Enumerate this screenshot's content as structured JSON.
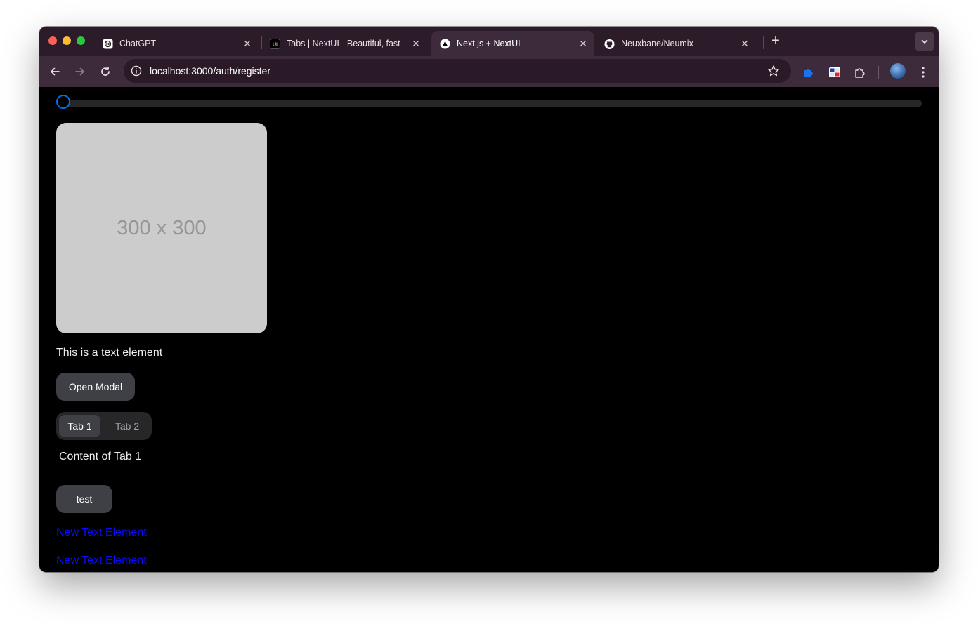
{
  "browser": {
    "tabs": [
      {
        "title": "ChatGPT",
        "icon": "chatgpt-icon",
        "active": false
      },
      {
        "title": "Tabs | NextUI - Beautiful, fast",
        "icon": "nextui-icon",
        "active": false
      },
      {
        "title": "Next.js + NextUI",
        "icon": "nextjs-icon",
        "active": true
      },
      {
        "title": "Neuxbane/Neumix",
        "icon": "github-icon",
        "active": false
      }
    ],
    "new_tab_label": "+",
    "address": {
      "host": "localhost",
      "rest": ":3000/auth/register"
    }
  },
  "page": {
    "slider": {
      "value": 0
    },
    "image_placeholder_label": "300 x 300",
    "text_element": "This is a text element",
    "open_modal_label": "Open Modal",
    "tabs": [
      {
        "label": "Tab 1",
        "selected": true
      },
      {
        "label": "Tab 2",
        "selected": false
      }
    ],
    "tab_content": "Content of Tab 1",
    "test_button_label": "test",
    "links": [
      "New Text Element",
      "New Text Element"
    ]
  },
  "colors": {
    "accent": "#006fee",
    "link": "#0a0aff",
    "page_bg": "#000000",
    "tabstrip_bg": "#2c1c2a",
    "toolbar_bg": "#3d2a3a"
  }
}
